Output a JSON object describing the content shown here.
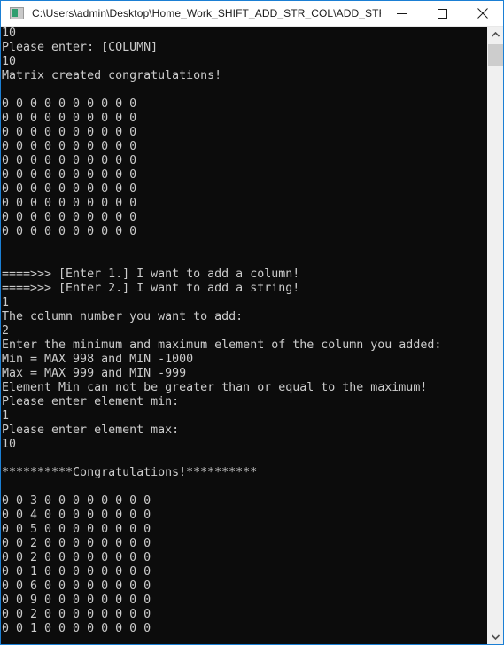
{
  "window": {
    "title": "C:\\Users\\admin\\Desktop\\Home_Work_SHIFT_ADD_STR_COL\\ADD_STR_C...",
    "icon": "console-window-icon",
    "border_color": "#1b7fd4",
    "titlebar_bg": "#ffffff",
    "titlebar_fg": "#1a1a1a"
  },
  "caption_buttons": {
    "minimize": {
      "name": "minimize-button",
      "glyph": "—"
    },
    "maximize": {
      "name": "maximize-button",
      "glyph": "□"
    },
    "close": {
      "name": "close-button",
      "glyph": "✕"
    }
  },
  "console": {
    "background": "#0c0c0c",
    "foreground": "#cccccc",
    "lines": [
      "10",
      "Please enter: [COLUMN]",
      "10",
      "Matrix created congratulations!",
      "",
      "0 0 0 0 0 0 0 0 0 0",
      "0 0 0 0 0 0 0 0 0 0",
      "0 0 0 0 0 0 0 0 0 0",
      "0 0 0 0 0 0 0 0 0 0",
      "0 0 0 0 0 0 0 0 0 0",
      "0 0 0 0 0 0 0 0 0 0",
      "0 0 0 0 0 0 0 0 0 0",
      "0 0 0 0 0 0 0 0 0 0",
      "0 0 0 0 0 0 0 0 0 0",
      "0 0 0 0 0 0 0 0 0 0",
      "",
      "",
      "====>>> [Enter 1.] I want to add a column!",
      "====>>> [Enter 2.] I want to add a string!",
      "1",
      "The column number you want to add:",
      "2",
      "Enter the minimum and maximum element of the column you added:",
      "Min = MAX 998 and MIN -1000",
      "Max = MAX 999 and MIN -999",
      "Element Min can not be greater than or equal to the maximum!",
      "Please enter element min:",
      "1",
      "Please enter element max:",
      "10",
      "",
      "**********Congratulations!**********",
      "",
      "0 0 3 0 0 0 0 0 0 0 0",
      "0 0 4 0 0 0 0 0 0 0 0",
      "0 0 5 0 0 0 0 0 0 0 0",
      "0 0 2 0 0 0 0 0 0 0 0",
      "0 0 2 0 0 0 0 0 0 0 0",
      "0 0 1 0 0 0 0 0 0 0 0",
      "0 0 6 0 0 0 0 0 0 0 0",
      "0 0 9 0 0 0 0 0 0 0 0",
      "0 0 2 0 0 0 0 0 0 0 0",
      "0 0 1 0 0 0 0 0 0 0 0"
    ]
  },
  "scrollbar": {
    "up_arrow": "chevron-up-icon",
    "down_arrow": "chevron-down-icon",
    "track_color": "#f0f0f0",
    "thumb_color": "#cdcdcd"
  }
}
